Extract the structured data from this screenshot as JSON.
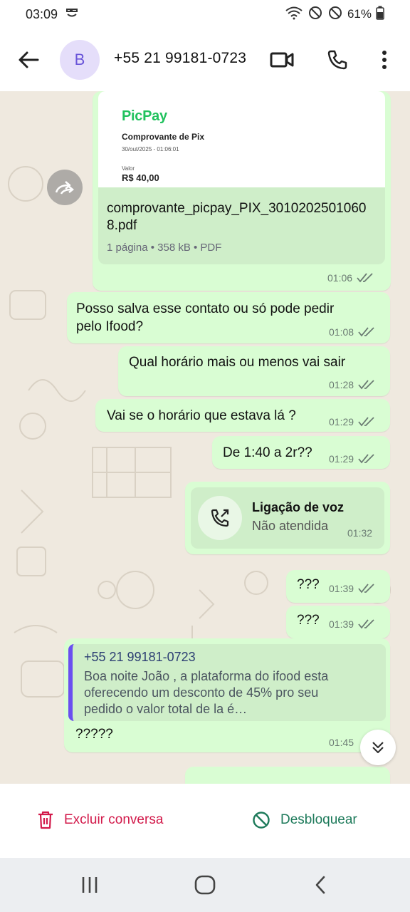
{
  "status_bar": {
    "time": "03:09",
    "battery": "61%",
    "icons": [
      "wifi-icon",
      "do-not-disturb-icon",
      "do-not-disturb-icon",
      "battery-icon"
    ]
  },
  "header": {
    "avatar_letter": "B",
    "contact_name": "+55 21 99181-0723",
    "icons": [
      "back-arrow-icon",
      "video-call-icon",
      "phone-icon",
      "more-options-icon"
    ]
  },
  "messages": [
    {
      "type": "document",
      "preview": {
        "brand": "PicPay",
        "title": "Comprovante de Pix",
        "date": "30/out/2025 - 01:06:01",
        "value_label": "Valor",
        "value": "R$ 40,00"
      },
      "filename": "comprovante_picpay_PIX_30102025010608.pdf",
      "info": "1 página • 358 kB • PDF",
      "time": "01:06"
    },
    {
      "type": "text",
      "text_line1": "Posso salva esse contato ou só pode pedir",
      "text_line2": "pelo Ifood?",
      "time": "01:08"
    },
    {
      "type": "text",
      "text": "Qual horário mais ou menos vai sair",
      "time": "01:28"
    },
    {
      "type": "text",
      "text": "Vai se o horário que estava lá ?",
      "time": "01:29"
    },
    {
      "type": "text",
      "text": "De 1:40 a 2r??",
      "time": "01:29"
    },
    {
      "type": "call",
      "title": "Ligação de voz",
      "subtitle": "Não atendida",
      "time": "01:32"
    },
    {
      "type": "text",
      "text": "???",
      "time": "01:39"
    },
    {
      "type": "text",
      "text": "???",
      "time": "01:39"
    },
    {
      "type": "reply",
      "quote_name": "+55 21 99181-0723",
      "quote_line1": "Boa noite João   , a plataforma do ifood esta",
      "quote_line2": "oferecendo um desconto de 45% pro seu",
      "quote_line3": "pedido o valor total de la é…",
      "text": "?????",
      "time": "01:45"
    }
  ],
  "actions": {
    "delete_label": "Excluir conversa",
    "unblock_label": "Desbloquear"
  },
  "colors": {
    "bubble": "#d9fdd3",
    "delete": "#d2194a",
    "unblock": "#1d7a5a",
    "quote_bar": "#6a4ff0"
  }
}
